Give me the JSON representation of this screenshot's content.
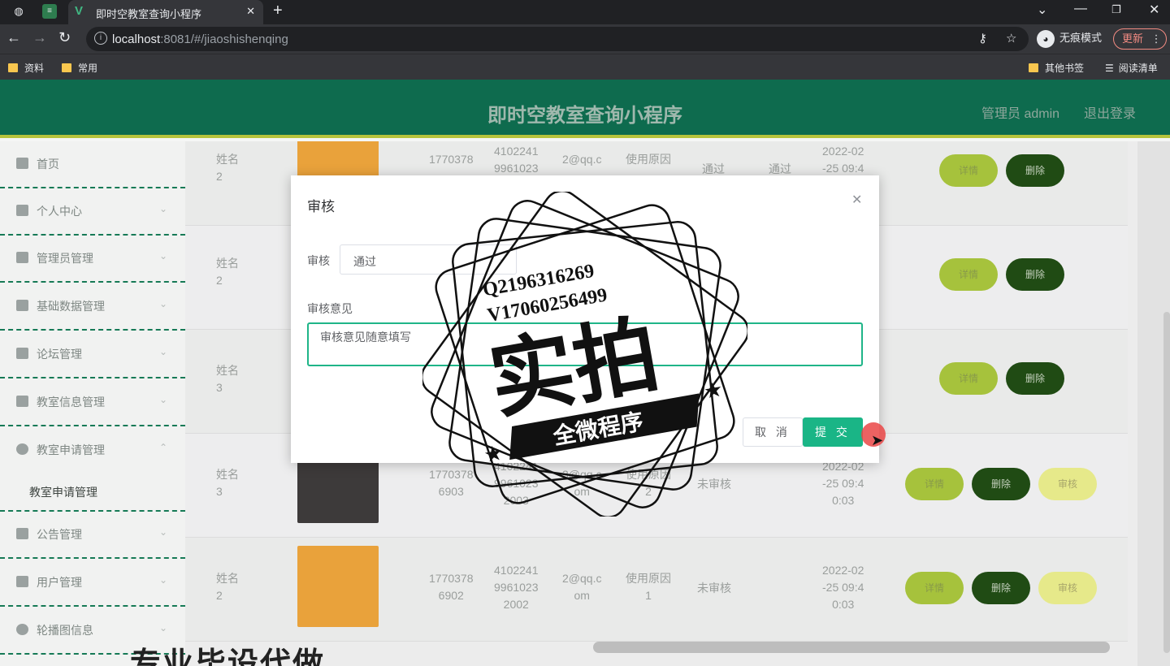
{
  "browser": {
    "tab_title": "即时空教室查询小程序",
    "url_host": "localhost",
    "url_path": ":8081/#/jiaoshishenqing",
    "incognito_label": "无痕模式",
    "update_label": "更新",
    "bookmarks": [
      "资料",
      "常用",
      "其他书签",
      "阅读清单"
    ]
  },
  "header": {
    "title": "即时空教室查询小程序",
    "user": "管理员 admin",
    "logout": "退出登录"
  },
  "sidebar": {
    "items": [
      {
        "label": "首页",
        "icon": "home-icon"
      },
      {
        "label": "个人中心",
        "icon": "user-icon"
      },
      {
        "label": "管理员管理",
        "icon": "mic-icon"
      },
      {
        "label": "基础数据管理",
        "icon": "box-icon"
      },
      {
        "label": "论坛管理",
        "icon": "crop-icon"
      },
      {
        "label": "教室信息管理",
        "icon": "chat-icon"
      },
      {
        "label": "教室申请管理",
        "icon": "globe-icon"
      },
      {
        "label": "公告管理",
        "icon": "ticket-icon"
      },
      {
        "label": "用户管理",
        "icon": "printer-icon"
      },
      {
        "label": "轮播图信息",
        "icon": "power-icon"
      }
    ],
    "sub_item": "教室申请管理"
  },
  "table": {
    "rows": [
      {
        "name": "姓名\n2",
        "phone": "1770378",
        "idcard": "4102241\n9961023",
        "email": "2@qq.c",
        "reason": "使用原因",
        "status": "通过",
        "status2": "通过",
        "time": "2022-02\n-25 09:4",
        "buttons": [
          "详情",
          "删除"
        ]
      },
      {
        "name": "姓名\n2",
        "phone": "",
        "idcard": "",
        "email": "",
        "reason": "",
        "status": "",
        "status2": "",
        "time": "",
        "buttons": [
          "详情",
          "删除"
        ]
      },
      {
        "name": "姓名\n3",
        "phone": "",
        "idcard": "",
        "email": "",
        "reason": "",
        "status": "",
        "status2": "",
        "time": "",
        "buttons": [
          "详情",
          "删除"
        ]
      },
      {
        "name": "姓名\n3",
        "phone": "1770378\n6903",
        "idcard": "4102241\n9961023\n2003",
        "email": "3@qq.c\nom",
        "reason": "使用原因\n2",
        "status": "未审核",
        "status2": "",
        "time": "2022-02\n-25 09:4\n0:03",
        "buttons": [
          "详情",
          "删除",
          "审核"
        ]
      },
      {
        "name": "姓名\n2",
        "phone": "1770378\n6902",
        "idcard": "4102241\n9961023\n2002",
        "email": "2@qq.c\nom",
        "reason": "使用原因\n1",
        "status": "未审核",
        "status2": "",
        "time": "2022-02\n-25 09:4\n0:03",
        "buttons": [
          "详情",
          "删除",
          "审核"
        ]
      }
    ]
  },
  "dialog": {
    "title": "审核",
    "field_label": "审核",
    "select_value": "通过",
    "opinion_label": "审核意见",
    "opinion_value": "审核意见随意填写",
    "cancel": "取 消",
    "submit": "提 交"
  },
  "stamp": {
    "qq": "Q2196316269",
    "vx": "V17060256499",
    "big": "实拍",
    "banner": "全微程序"
  },
  "overlay_text": "专业毕设代做",
  "colors": {
    "header": "#0e6b4e",
    "accent": "#1ab586",
    "divider": "#167a56",
    "detail_btn": "#a6c23c",
    "delete_btn": "#204b14",
    "audit_btn": "#e6e98a"
  }
}
